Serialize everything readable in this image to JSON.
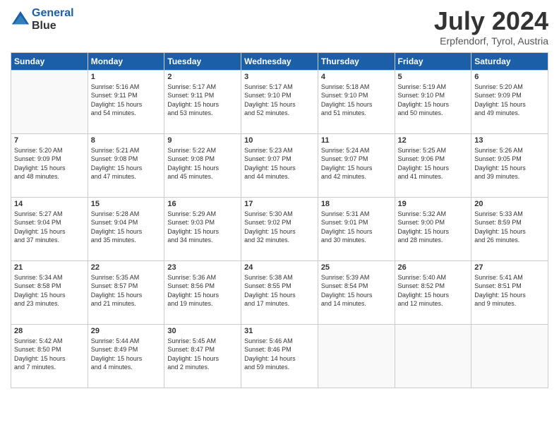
{
  "header": {
    "logo_line1": "General",
    "logo_line2": "Blue",
    "title": "July 2024",
    "location": "Erpfendorf, Tyrol, Austria"
  },
  "days_of_week": [
    "Sunday",
    "Monday",
    "Tuesday",
    "Wednesday",
    "Thursday",
    "Friday",
    "Saturday"
  ],
  "weeks": [
    [
      {
        "day": "",
        "info": ""
      },
      {
        "day": "1",
        "info": "Sunrise: 5:16 AM\nSunset: 9:11 PM\nDaylight: 15 hours\nand 54 minutes."
      },
      {
        "day": "2",
        "info": "Sunrise: 5:17 AM\nSunset: 9:11 PM\nDaylight: 15 hours\nand 53 minutes."
      },
      {
        "day": "3",
        "info": "Sunrise: 5:17 AM\nSunset: 9:10 PM\nDaylight: 15 hours\nand 52 minutes."
      },
      {
        "day": "4",
        "info": "Sunrise: 5:18 AM\nSunset: 9:10 PM\nDaylight: 15 hours\nand 51 minutes."
      },
      {
        "day": "5",
        "info": "Sunrise: 5:19 AM\nSunset: 9:10 PM\nDaylight: 15 hours\nand 50 minutes."
      },
      {
        "day": "6",
        "info": "Sunrise: 5:20 AM\nSunset: 9:09 PM\nDaylight: 15 hours\nand 49 minutes."
      }
    ],
    [
      {
        "day": "7",
        "info": "Sunrise: 5:20 AM\nSunset: 9:09 PM\nDaylight: 15 hours\nand 48 minutes."
      },
      {
        "day": "8",
        "info": "Sunrise: 5:21 AM\nSunset: 9:08 PM\nDaylight: 15 hours\nand 47 minutes."
      },
      {
        "day": "9",
        "info": "Sunrise: 5:22 AM\nSunset: 9:08 PM\nDaylight: 15 hours\nand 45 minutes."
      },
      {
        "day": "10",
        "info": "Sunrise: 5:23 AM\nSunset: 9:07 PM\nDaylight: 15 hours\nand 44 minutes."
      },
      {
        "day": "11",
        "info": "Sunrise: 5:24 AM\nSunset: 9:07 PM\nDaylight: 15 hours\nand 42 minutes."
      },
      {
        "day": "12",
        "info": "Sunrise: 5:25 AM\nSunset: 9:06 PM\nDaylight: 15 hours\nand 41 minutes."
      },
      {
        "day": "13",
        "info": "Sunrise: 5:26 AM\nSunset: 9:05 PM\nDaylight: 15 hours\nand 39 minutes."
      }
    ],
    [
      {
        "day": "14",
        "info": "Sunrise: 5:27 AM\nSunset: 9:04 PM\nDaylight: 15 hours\nand 37 minutes."
      },
      {
        "day": "15",
        "info": "Sunrise: 5:28 AM\nSunset: 9:04 PM\nDaylight: 15 hours\nand 35 minutes."
      },
      {
        "day": "16",
        "info": "Sunrise: 5:29 AM\nSunset: 9:03 PM\nDaylight: 15 hours\nand 34 minutes."
      },
      {
        "day": "17",
        "info": "Sunrise: 5:30 AM\nSunset: 9:02 PM\nDaylight: 15 hours\nand 32 minutes."
      },
      {
        "day": "18",
        "info": "Sunrise: 5:31 AM\nSunset: 9:01 PM\nDaylight: 15 hours\nand 30 minutes."
      },
      {
        "day": "19",
        "info": "Sunrise: 5:32 AM\nSunset: 9:00 PM\nDaylight: 15 hours\nand 28 minutes."
      },
      {
        "day": "20",
        "info": "Sunrise: 5:33 AM\nSunset: 8:59 PM\nDaylight: 15 hours\nand 26 minutes."
      }
    ],
    [
      {
        "day": "21",
        "info": "Sunrise: 5:34 AM\nSunset: 8:58 PM\nDaylight: 15 hours\nand 23 minutes."
      },
      {
        "day": "22",
        "info": "Sunrise: 5:35 AM\nSunset: 8:57 PM\nDaylight: 15 hours\nand 21 minutes."
      },
      {
        "day": "23",
        "info": "Sunrise: 5:36 AM\nSunset: 8:56 PM\nDaylight: 15 hours\nand 19 minutes."
      },
      {
        "day": "24",
        "info": "Sunrise: 5:38 AM\nSunset: 8:55 PM\nDaylight: 15 hours\nand 17 minutes."
      },
      {
        "day": "25",
        "info": "Sunrise: 5:39 AM\nSunset: 8:54 PM\nDaylight: 15 hours\nand 14 minutes."
      },
      {
        "day": "26",
        "info": "Sunrise: 5:40 AM\nSunset: 8:52 PM\nDaylight: 15 hours\nand 12 minutes."
      },
      {
        "day": "27",
        "info": "Sunrise: 5:41 AM\nSunset: 8:51 PM\nDaylight: 15 hours\nand 9 minutes."
      }
    ],
    [
      {
        "day": "28",
        "info": "Sunrise: 5:42 AM\nSunset: 8:50 PM\nDaylight: 15 hours\nand 7 minutes."
      },
      {
        "day": "29",
        "info": "Sunrise: 5:44 AM\nSunset: 8:49 PM\nDaylight: 15 hours\nand 4 minutes."
      },
      {
        "day": "30",
        "info": "Sunrise: 5:45 AM\nSunset: 8:47 PM\nDaylight: 15 hours\nand 2 minutes."
      },
      {
        "day": "31",
        "info": "Sunrise: 5:46 AM\nSunset: 8:46 PM\nDaylight: 14 hours\nand 59 minutes."
      },
      {
        "day": "",
        "info": ""
      },
      {
        "day": "",
        "info": ""
      },
      {
        "day": "",
        "info": ""
      }
    ]
  ]
}
